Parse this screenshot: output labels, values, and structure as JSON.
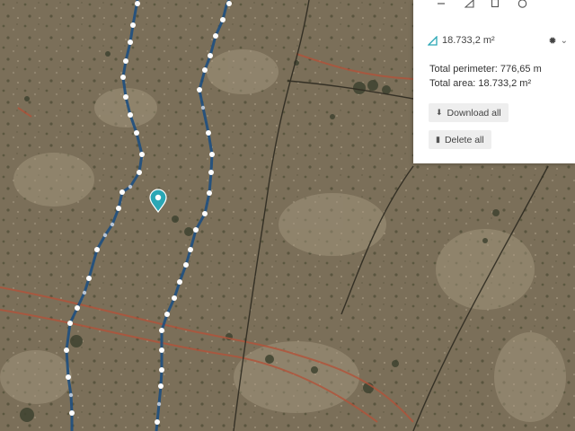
{
  "map": {
    "background": "#7a6e58",
    "path_color": "#1e4f80",
    "vertex_color": "#ffffff",
    "marker_color": "#2aa7b5",
    "road_color": "#b2533a",
    "icons": [
      "location-pin-icon"
    ]
  },
  "panel": {
    "tools": [
      {
        "name": "line-tool-icon",
        "glyph": "–"
      },
      {
        "name": "area-tool-icon",
        "glyph": "◿"
      },
      {
        "name": "rectangle-tool-icon",
        "glyph": "□"
      },
      {
        "name": "circle-tool-icon",
        "glyph": "○"
      }
    ],
    "shape": {
      "icon": "area-icon",
      "area_label": "18.733,2 m²",
      "settings_icon": "gear-icon",
      "more_glyph": "⌄"
    },
    "summary": {
      "perimeter_text": "Total perimeter: 776,65 m",
      "area_text": "Total area: 18.733,2 m²"
    },
    "buttons": {
      "download_label": "Download all",
      "download_icon": "download-icon",
      "delete_label": "Delete all",
      "delete_icon": "trash-icon"
    }
  }
}
